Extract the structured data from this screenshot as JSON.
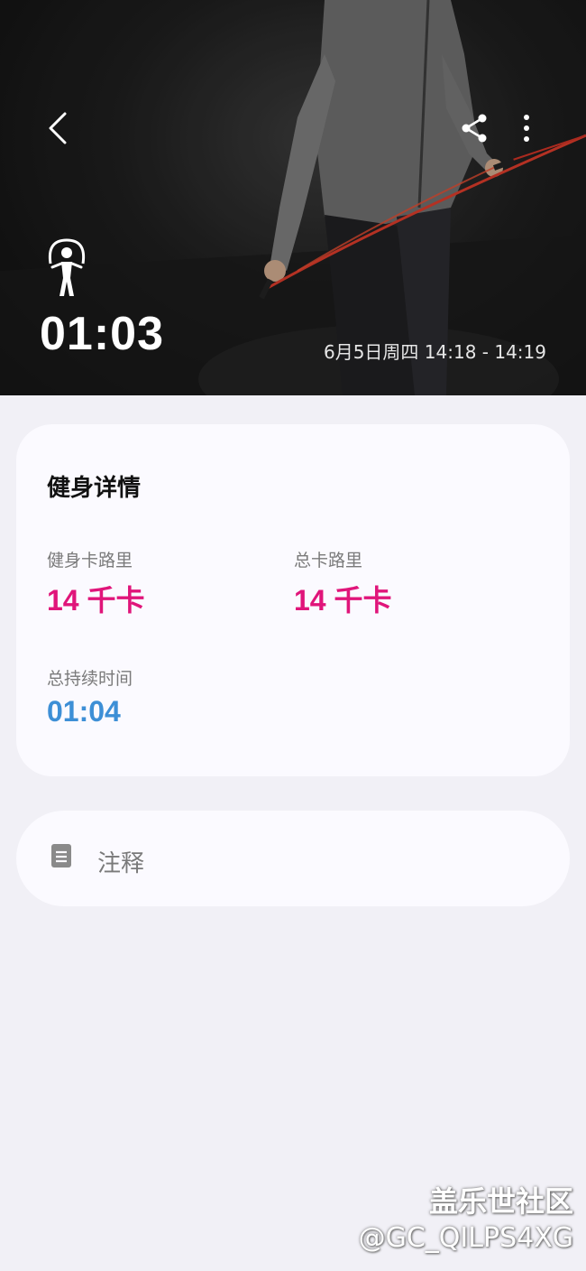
{
  "header": {
    "duration": "01:03",
    "datetime": "6月5日周四 14:18 - 14:19",
    "back_icon": "chevron-left-icon",
    "share_icon": "share-icon",
    "more_icon": "more-vertical-icon",
    "activity_icon": "jump-rope-icon"
  },
  "details": {
    "title": "健身详情",
    "metrics": [
      {
        "label": "健身卡路里",
        "value": "14 千卡",
        "color": "#e0157a"
      },
      {
        "label": "总卡路里",
        "value": "14 千卡",
        "color": "#e0157a"
      },
      {
        "label": "总持续时间",
        "value": "01:04",
        "color": "#3d8fd6"
      }
    ]
  },
  "note": {
    "label": "注释",
    "icon": "note-icon"
  },
  "watermark": {
    "line1": "盖乐世社区",
    "line2": "@GC_QILPS4XG"
  }
}
